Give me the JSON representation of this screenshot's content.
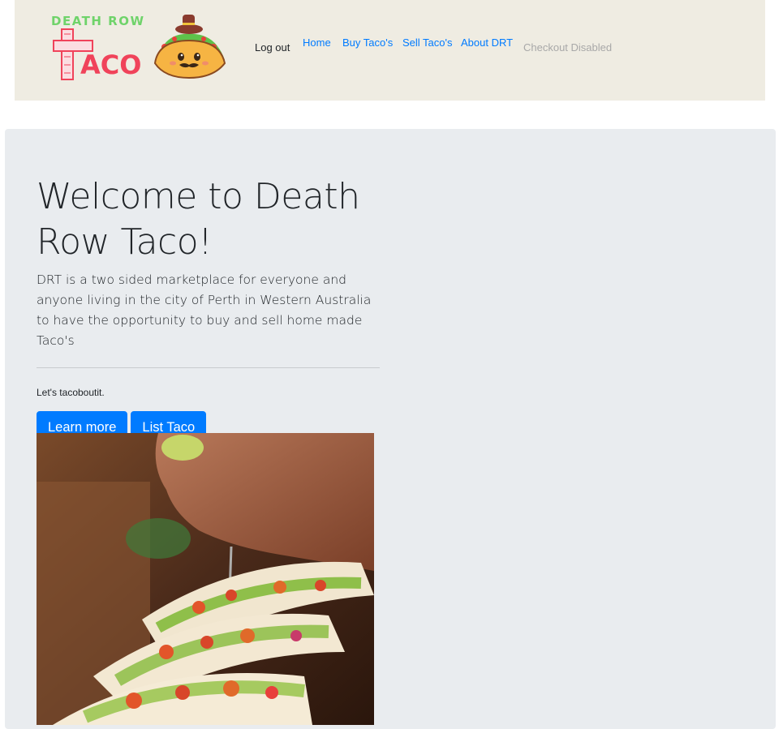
{
  "brand": {
    "logo_line1": "DEATH ROW",
    "logo_line2": "TACO"
  },
  "nav": {
    "logout": "Log out",
    "home": "Home",
    "buy": "Buy Taco's",
    "sell": "Sell Taco's",
    "about": "About DRT",
    "checkout": "Checkout Disabled"
  },
  "hero": {
    "heading": "Welcome to Death Row Taco!",
    "lead": "DRT is a two sided marketplace for everyone and anyone living in the city of Perth in Western Australia to have the opportunity to buy and sell home made Taco's",
    "tagline": "Let's tacoboutit.",
    "learn_more": "Learn more",
    "list_taco": "List Taco"
  },
  "colors": {
    "navbar_bg": "#efece2",
    "link": "#007bff",
    "button": "#007bff",
    "jumbotron_bg": "#e9ecef",
    "logo_green": "#6fd36a",
    "logo_red": "#f0435a"
  }
}
